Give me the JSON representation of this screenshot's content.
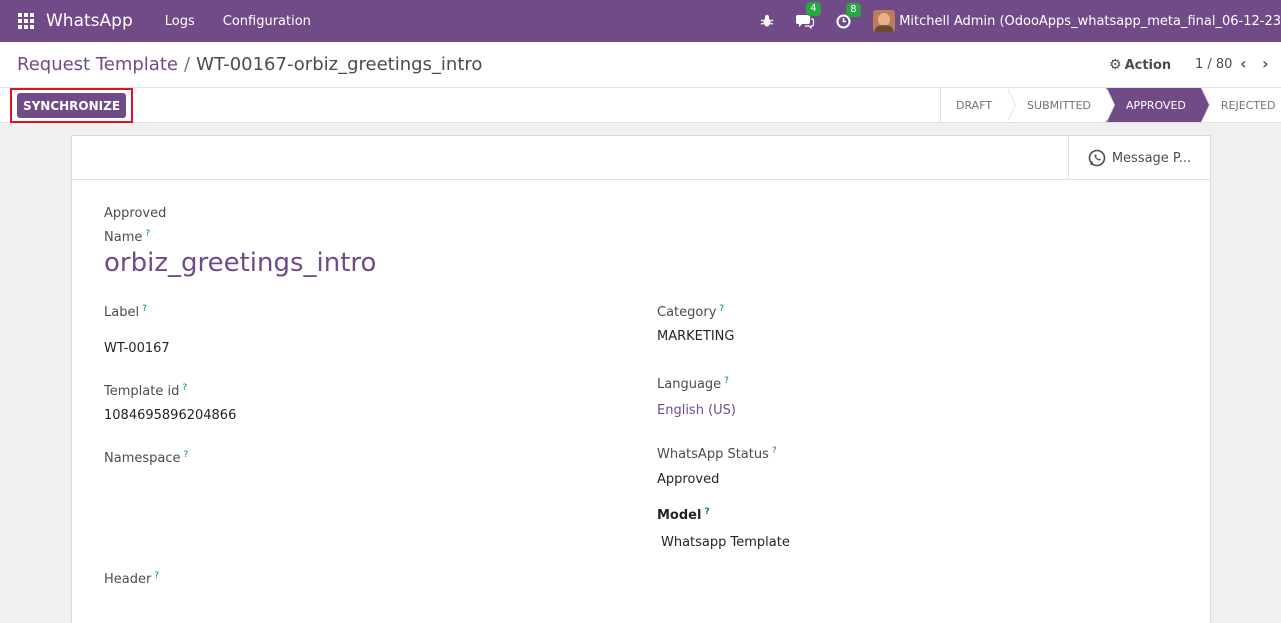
{
  "navbar": {
    "app_name": "WhatsApp",
    "menu": [
      "Logs",
      "Configuration"
    ],
    "chat_badge": "4",
    "activity_badge": "8",
    "user_label": "Mitchell Admin (OdooApps_whatsapp_meta_final_06-12-23"
  },
  "breadcrumb": {
    "parent": "Request Template",
    "separator": "/",
    "current": "WT-00167-orbiz_greetings_intro"
  },
  "toolbar": {
    "action_label": "Action",
    "pager": "1 / 80",
    "sync_label": "SYNCHRONIZE"
  },
  "statusbar": {
    "stages": [
      "DRAFT",
      "SUBMITTED",
      "APPROVED",
      "REJECTED"
    ],
    "active": "APPROVED"
  },
  "smart_button": {
    "label": "Message P..."
  },
  "form": {
    "status_text": "Approved",
    "name_label": "Name",
    "name_value": "orbiz_greetings_intro",
    "help_mark": "?",
    "left": {
      "label_label": "Label",
      "label_value": "WT-00167",
      "template_id_label": "Template id",
      "template_id_value": "1084695896204866",
      "namespace_label": "Namespace",
      "header_label": "Header"
    },
    "right": {
      "category_label": "Category",
      "category_value": "MARKETING",
      "language_label": "Language",
      "language_value": "English (US)",
      "wa_status_label": "WhatsApp Status",
      "wa_status_value": "Approved",
      "model_label": "Model",
      "model_value": "Whatsapp Template"
    }
  },
  "colors": {
    "brand": "#714b88",
    "badge": "#28a745",
    "highlight": "#e0141e"
  }
}
